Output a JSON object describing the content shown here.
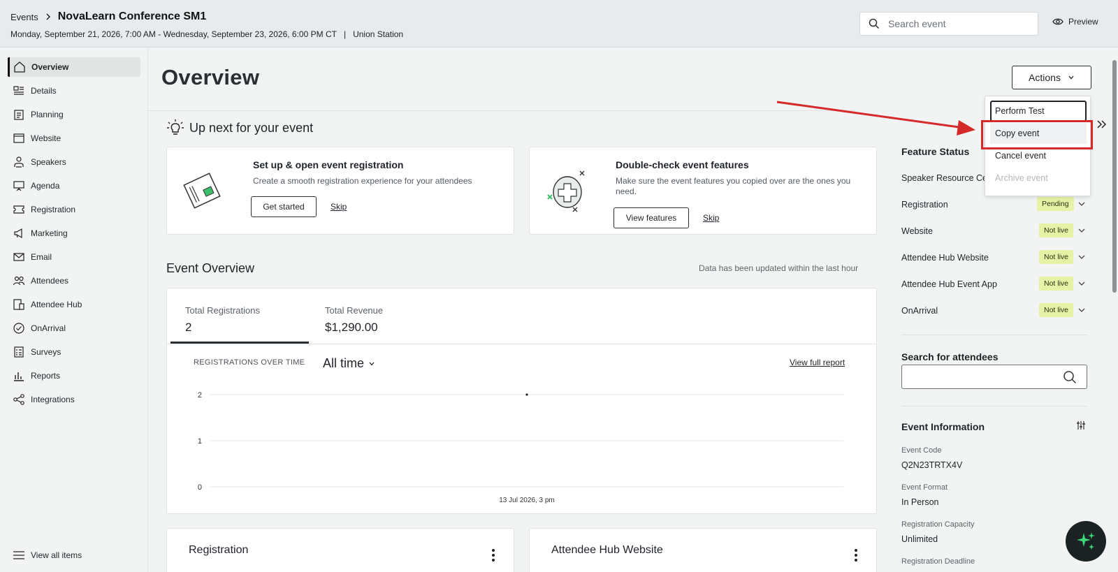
{
  "header": {
    "breadcrumb_root": "Events",
    "event_title": "NovaLearn Conference SM1",
    "event_dates": "Monday, September 21, 2026, 7:00 AM - Wednesday, September 23, 2026, 6:00 PM CT",
    "separator": "|",
    "venue": "Union Station",
    "search_placeholder": "Search event",
    "preview_label": "Preview"
  },
  "sidebar": {
    "items": [
      {
        "label": "Overview",
        "icon": "home-icon",
        "active": true
      },
      {
        "label": "Details",
        "icon": "details-icon"
      },
      {
        "label": "Planning",
        "icon": "clipboard-icon"
      },
      {
        "label": "Website",
        "icon": "browser-icon"
      },
      {
        "label": "Speakers",
        "icon": "speaker-icon"
      },
      {
        "label": "Agenda",
        "icon": "presentation-icon"
      },
      {
        "label": "Registration",
        "icon": "ticket-icon"
      },
      {
        "label": "Marketing",
        "icon": "megaphone-icon"
      },
      {
        "label": "Email",
        "icon": "envelope-icon"
      },
      {
        "label": "Attendees",
        "icon": "people-icon"
      },
      {
        "label": "Attendee Hub",
        "icon": "devices-icon"
      },
      {
        "label": "OnArrival",
        "icon": "check-circle-icon"
      },
      {
        "label": "Surveys",
        "icon": "survey-icon"
      },
      {
        "label": "Reports",
        "icon": "bar-chart-icon"
      },
      {
        "label": "Integrations",
        "icon": "share-icon"
      }
    ],
    "view_all": "View all items"
  },
  "main": {
    "title": "Overview",
    "actions_label": "Actions",
    "up_next_title": "Up next for your event",
    "cards": [
      {
        "title": "Set up & open event registration",
        "desc": "Create a smooth registration experience for your attendees",
        "primary": "Get started",
        "secondary": "Skip"
      },
      {
        "title": "Double-check event features",
        "desc": "Make sure the event features you copied over are the ones you need.",
        "primary": "View features",
        "secondary": "Skip"
      }
    ],
    "event_overview_title": "Event Overview",
    "updated_note": "Data has been updated within the last hour",
    "metrics": [
      {
        "label": "Total Registrations",
        "value": "2"
      },
      {
        "label": "Total Revenue",
        "value": "$1,290.00"
      }
    ],
    "chart_caption": "REGISTRATIONS OVER TIME",
    "time_filter": "All time",
    "view_report": "View full report",
    "bottom_cards": [
      {
        "title": "Registration"
      },
      {
        "title": "Attendee Hub Website"
      }
    ]
  },
  "chart_data": {
    "type": "scatter",
    "x": [
      "13 Jul 2026, 3 pm"
    ],
    "values": [
      2
    ],
    "yticks": [
      "0",
      "1",
      "2"
    ],
    "ylim": [
      0,
      2
    ],
    "xlabel": "",
    "ylabel": "",
    "grid": true
  },
  "dropdown": {
    "items": [
      {
        "label": "Perform Test",
        "state": "focused"
      },
      {
        "label": "Copy event",
        "state": "hover"
      },
      {
        "label": "Cancel event",
        "state": "normal"
      },
      {
        "label": "Archive event",
        "state": "disabled"
      }
    ]
  },
  "feature_status": {
    "title": "Feature Status",
    "items": [
      {
        "label": "Speaker Resource Ce",
        "status": ""
      },
      {
        "label": "Registration",
        "status": "Pending"
      },
      {
        "label": "Website",
        "status": "Not live"
      },
      {
        "label": "Attendee Hub Website",
        "status": "Not live"
      },
      {
        "label": "Attendee Hub Event App",
        "status": "Not live"
      },
      {
        "label": "OnArrival",
        "status": "Not live"
      }
    ]
  },
  "attendee_search": {
    "title": "Search for attendees",
    "placeholder": ""
  },
  "event_info": {
    "title": "Event Information",
    "fields": [
      {
        "label": "Event Code",
        "value": "Q2N23TRTX4V"
      },
      {
        "label": "Event Format",
        "value": "In Person"
      },
      {
        "label": "Registration Capacity",
        "value": "Unlimited"
      },
      {
        "label": "Registration Deadline",
        "value": ""
      }
    ]
  },
  "colors": {
    "accent_red": "#d42a2a",
    "badge_bg": "#e6f2a6",
    "ai_icon": "#3ddc7a"
  }
}
